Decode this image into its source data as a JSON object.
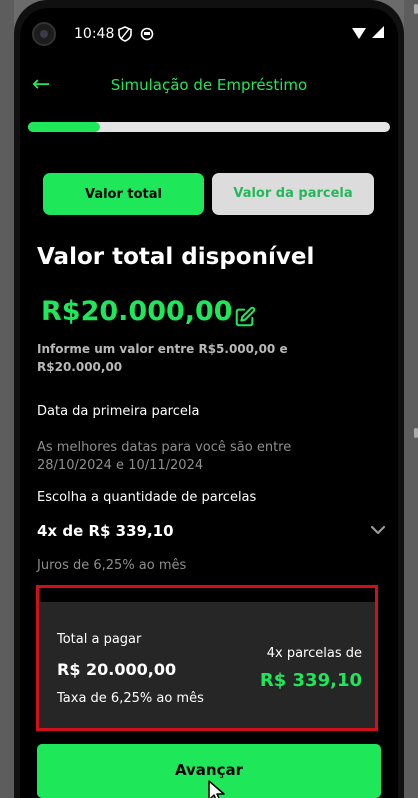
{
  "status_bar": {
    "time": "10:48",
    "icons": [
      "shield-icon",
      "status-app-icon",
      "wifi-icon",
      "signal-icon"
    ]
  },
  "header": {
    "back_icon": "arrow-left-icon",
    "title": "Simulação de Empréstimo"
  },
  "progress": {
    "fraction": 0.2
  },
  "tabs": [
    {
      "label": "Valor total",
      "selected": true
    },
    {
      "label": "Valor da parcela",
      "selected": false
    }
  ],
  "main": {
    "heading": "Valor total disponível",
    "amount": "R$20.000,00",
    "edit_icon": "pencil-edit-icon",
    "hint": "Informe um valor entre R$5.000,00 e R$20.000,00",
    "first_installment_label": "Data da primeira parcela",
    "dates_hint": "As melhores datas para você são entre 28/10/2024 e 10/11/2024",
    "quantity_label": "Escolha a quantidade de parcelas",
    "quantity_value": "4x de R$ 339,10",
    "chevron_icon": "chevron-down-icon",
    "interest": "Juros de 6,25% ao mês"
  },
  "summary": {
    "total_label": "Total a pagar",
    "total_value": "R$ 20.000,00",
    "rate": "Taxa de 6,25% ao mês",
    "installments_label": "4x parcelas de",
    "installments_value": "R$ 339,10"
  },
  "cta": {
    "label": "Avançar"
  },
  "colors": {
    "accent": "#1ee85a",
    "background": "#000000",
    "summary_bg": "#262626",
    "highlight_border": "#d10f18",
    "tab_inactive_bg": "#dcdcdc"
  }
}
